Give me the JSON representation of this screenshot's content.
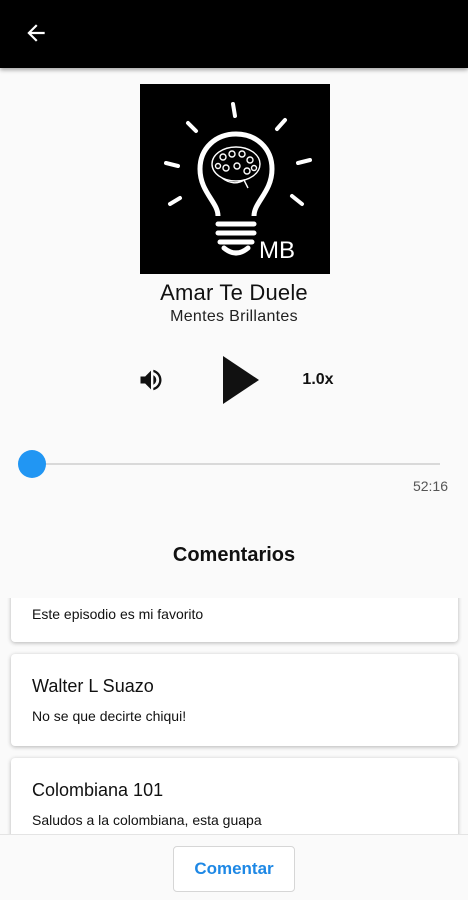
{
  "app_bar": {
    "back_icon": "arrow-back-icon"
  },
  "episode": {
    "title": "Amar Te Duele",
    "author": "Mentes Brillantes",
    "cover_monogram": "MB"
  },
  "player": {
    "volume_icon": "volume-icon",
    "play_icon": "play-icon",
    "speed": "1.0x",
    "progress": 0.0,
    "duration": "52:16",
    "accent_color": "#2196f3"
  },
  "comments": {
    "heading": "Comentarios",
    "items": [
      {
        "name": "",
        "text": "Este episodio es mi favorito"
      },
      {
        "name": "Walter L Suazo",
        "text": "No se que decirte chiqui!"
      },
      {
        "name": "Colombiana 101",
        "text": "Saludos a la colombiana, esta guapa"
      }
    ],
    "button_label": "Comentar",
    "button_color": "#1e88e5"
  }
}
